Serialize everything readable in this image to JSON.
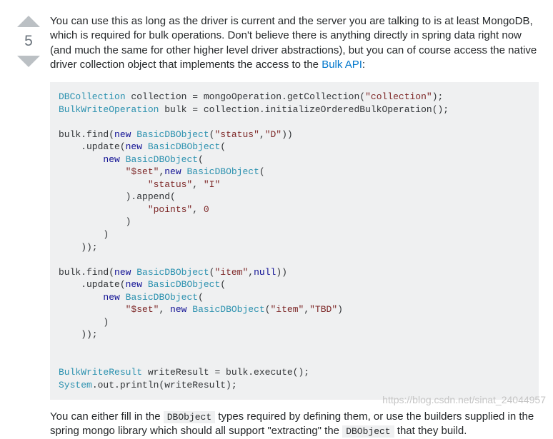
{
  "vote": {
    "count": "5"
  },
  "answer": {
    "intro_prefix": "You can use this as long as the driver is current and the server you are talking to is at least MongoDB, which is required for bulk operations. Don't believe there is anything directly in spring data right now (and much the same for other higher level driver abstractions), but you can of course access the native driver collection object that implements the access to the ",
    "link_text": "Bulk API",
    "intro_suffix": ":",
    "footer_1": "You can either fill in the ",
    "footer_code_1": "DBObject",
    "footer_2": " types required by defining them, or use the builders supplied in the spring mongo library which should all support \"extracting\" the ",
    "footer_code_2": "DBObject",
    "footer_3": " that they build."
  },
  "code": {
    "t_DBCollection": "DBCollection",
    "p_coll_eq": " collection = mongoOperation.getCollection(",
    "s_collection": "\"collection\"",
    "p_close_semi": ");",
    "t_BulkWriteOperation": "BulkWriteOperation",
    "p_bulk_eq": " bulk = collection.initializeOrderedBulkOperation();",
    "p_bulk_find": "bulk.find(",
    "k_new": "new",
    "t_BasicDBObject": "BasicDBObject",
    "p_open": "(",
    "s_status": "\"status\"",
    "p_comma": ",",
    "s_D": "\"D\"",
    "p_close2": "))",
    "p_update": "    .update(",
    "p_indent8": "        ",
    "s_set": "\"$set\"",
    "p_indent16": "                ",
    "p_comma_sp": ", ",
    "s_I": "\"I\"",
    "p_indent12": "            ",
    "p_append": ").append(",
    "s_points": "\"points\"",
    "l_0": "0",
    "p_close1": ")",
    "p_close_indent8": "        )",
    "p_close_indent4": "    ));",
    "s_item": "\"item\"",
    "k_null": "null",
    "s_TBD": "\"TBD\"",
    "t_BulkWriteResult": "BulkWriteResult",
    "p_writeResult": " writeResult = bulk.execute();",
    "t_System": "System",
    "p_out_print": ".out.println(writeResult);",
    "p_sp": " "
  },
  "watermark": "https://blog.csdn.net/sinat_24044957"
}
